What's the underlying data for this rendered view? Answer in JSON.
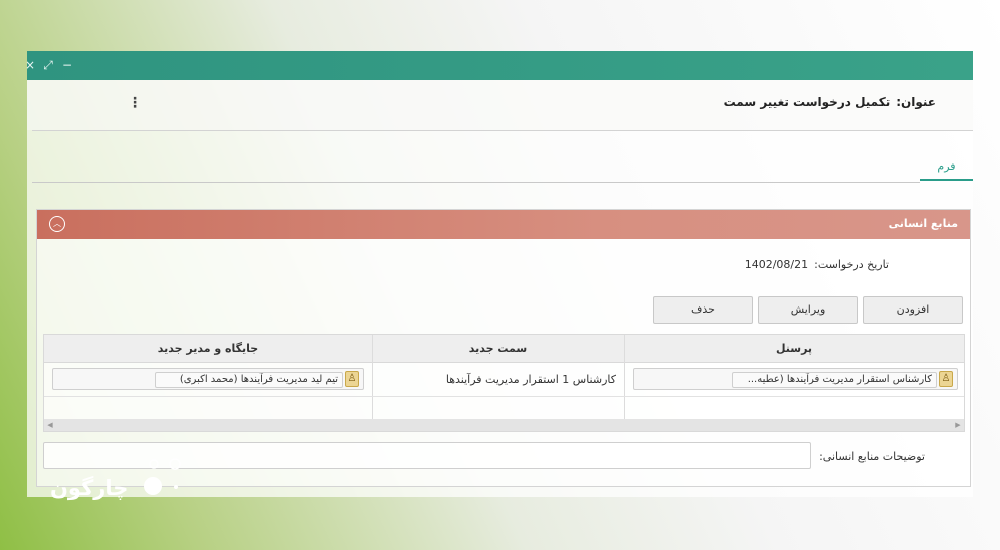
{
  "window": {
    "controls": {
      "close": "×",
      "maximize": "⤢",
      "minimize": "−"
    },
    "header": {
      "title_label": "عنوان:",
      "title_value": "تکمیل درخواست تغییر سمت",
      "menu_glyph": "⋮"
    },
    "tabs": [
      {
        "label": "فرم"
      }
    ]
  },
  "section": {
    "title": "منابع انسانی",
    "collapse_glyph": "︿",
    "request_date_label": "تاریخ درخواست:",
    "request_date_value": "1402/08/21",
    "buttons": {
      "add": "افزودن",
      "edit": "ویرایش",
      "delete": "حذف"
    },
    "grid": {
      "columns": [
        "پرسنل",
        "سمت جدید",
        "جایگاه و مدیر جدید"
      ],
      "rows": [
        {
          "personnel": "کارشناس استقرار مدیریت فرآیندها (عطیه...",
          "new_position": "کارشناس 1 استقرار مدیریت فرآیندها",
          "new_place_manager": "تیم لید مدیریت فرآیندها (محمد اکبری)"
        }
      ],
      "scroll_left": "◀",
      "scroll_right": "▶"
    },
    "description_label": "توضیحات منابع انسانی:",
    "description_value": ""
  },
  "brand": {
    "logo_text": "چارگون"
  },
  "colors": {
    "titlebar": "#2f9480",
    "section_header": "#c96f5e",
    "tab_accent": "#2a9d8a",
    "person_icon": "#ecd593"
  },
  "icons": {
    "close": "close-icon",
    "maximize": "maximize-icon",
    "minimize": "minimize-icon",
    "menu": "kebab-menu-icon",
    "collapse": "chevron-up-icon",
    "person": "person-icon"
  }
}
